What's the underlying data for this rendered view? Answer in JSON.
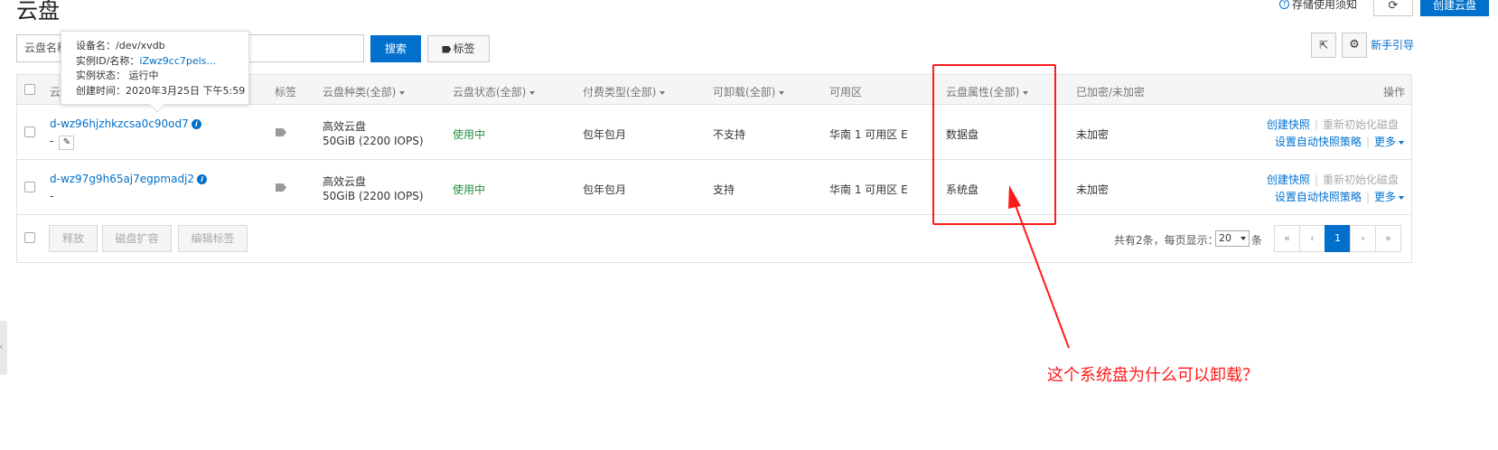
{
  "page": {
    "title": "云盘"
  },
  "top_actions": {
    "storage_notice": "存储使用须知",
    "refresh_icon": "refresh-icon",
    "create_disk": "创建云盘"
  },
  "toolbar": {
    "search_value": "云盘名称",
    "search_button": "搜索",
    "tag_button": "标签",
    "guide_link": "新手引导"
  },
  "table": {
    "headers": {
      "name": "云",
      "tags": "标签",
      "category": "云盘种类(全部)",
      "status": "云盘状态(全部)",
      "billing": "付费类型(全部)",
      "detachable": "可卸载(全部)",
      "zone": "可用区",
      "attribute": "云盘属性(全部)",
      "encrypted": "已加密/未加密",
      "operations": "操作"
    },
    "rows": [
      {
        "disk_id": "d-wz96hjzhkzcsa0c90od7",
        "sub": "-",
        "category": "高效云盘",
        "size": "50GiB (2200 IOPS)",
        "status": "使用中",
        "billing": "包年包月",
        "detachable": "不支持",
        "zone": "华南 1 可用区 E",
        "attribute": "数据盘",
        "encrypted": "未加密",
        "op_snapshot": "创建快照",
        "op_reinit": "重新初始化磁盘",
        "op_policy": "设置自动快照策略",
        "op_more": "更多"
      },
      {
        "disk_id": "d-wz97g9h65aj7egpmadj2",
        "sub": "-",
        "category": "高效云盘",
        "size": "50GiB (2200 IOPS)",
        "status": "使用中",
        "billing": "包年包月",
        "detachable": "支持",
        "zone": "华南 1 可用区 E",
        "attribute": "系统盘",
        "encrypted": "未加密",
        "op_snapshot": "创建快照",
        "op_reinit": "重新初始化磁盘",
        "op_policy": "设置自动快照策略",
        "op_more": "更多"
      }
    ]
  },
  "footer": {
    "release": "释放",
    "expand": "磁盘扩容",
    "edit_tags": "编辑标签",
    "total": "共有2条，每页显示：",
    "page_size": "20",
    "unit": "条",
    "pager": {
      "first": "«",
      "prev": "‹",
      "current": "1",
      "next": "›",
      "last": "»"
    }
  },
  "tooltip": {
    "device_line": "设备名：/dev/xvdb",
    "instance_label": "实例ID/名称：",
    "instance_value": "iZwz9cc7pels...",
    "state_line": "实例状态： 运行中",
    "created_line": "创建时间：2020年3月25日 下午5:59"
  },
  "annotation": {
    "text": "这个系统盘为什么可以卸载？",
    "color": "#ff1a1a"
  },
  "colors": {
    "accent": "#0070cc",
    "status_green": "#1e8e3e"
  }
}
